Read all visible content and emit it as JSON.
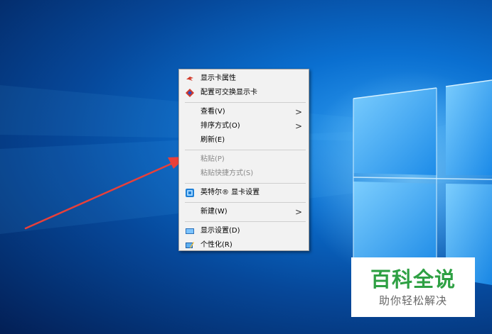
{
  "context_menu": {
    "items": [
      {
        "label": "显示卡属性",
        "icon": "graphics-properties-icon",
        "submenu": false,
        "disabled": false
      },
      {
        "label": "配置可交换显示卡",
        "icon": "switchable-graphics-icon",
        "submenu": false,
        "disabled": false
      },
      {
        "label": "查看(V)",
        "icon": "",
        "submenu": true,
        "disabled": false
      },
      {
        "label": "排序方式(O)",
        "icon": "",
        "submenu": true,
        "disabled": false
      },
      {
        "label": "刷新(E)",
        "icon": "",
        "submenu": false,
        "disabled": false
      },
      {
        "label": "粘贴(P)",
        "icon": "",
        "submenu": false,
        "disabled": true
      },
      {
        "label": "粘贴快捷方式(S)",
        "icon": "",
        "submenu": false,
        "disabled": true
      },
      {
        "label": "英特尔® 显卡设置",
        "icon": "intel-graphics-icon",
        "submenu": false,
        "disabled": false
      },
      {
        "label": "新建(W)",
        "icon": "",
        "submenu": true,
        "disabled": false
      },
      {
        "label": "显示设置(D)",
        "icon": "display-settings-icon",
        "submenu": false,
        "disabled": false
      },
      {
        "label": "个性化(R)",
        "icon": "personalize-icon",
        "submenu": false,
        "disabled": false
      }
    ],
    "submenu_arrow": ">"
  },
  "watermark": {
    "title": "百科全说",
    "subtitle": "助你轻松解决"
  },
  "colors": {
    "annotation_arrow": "#e8403a",
    "watermark_green": "#2ea043"
  }
}
